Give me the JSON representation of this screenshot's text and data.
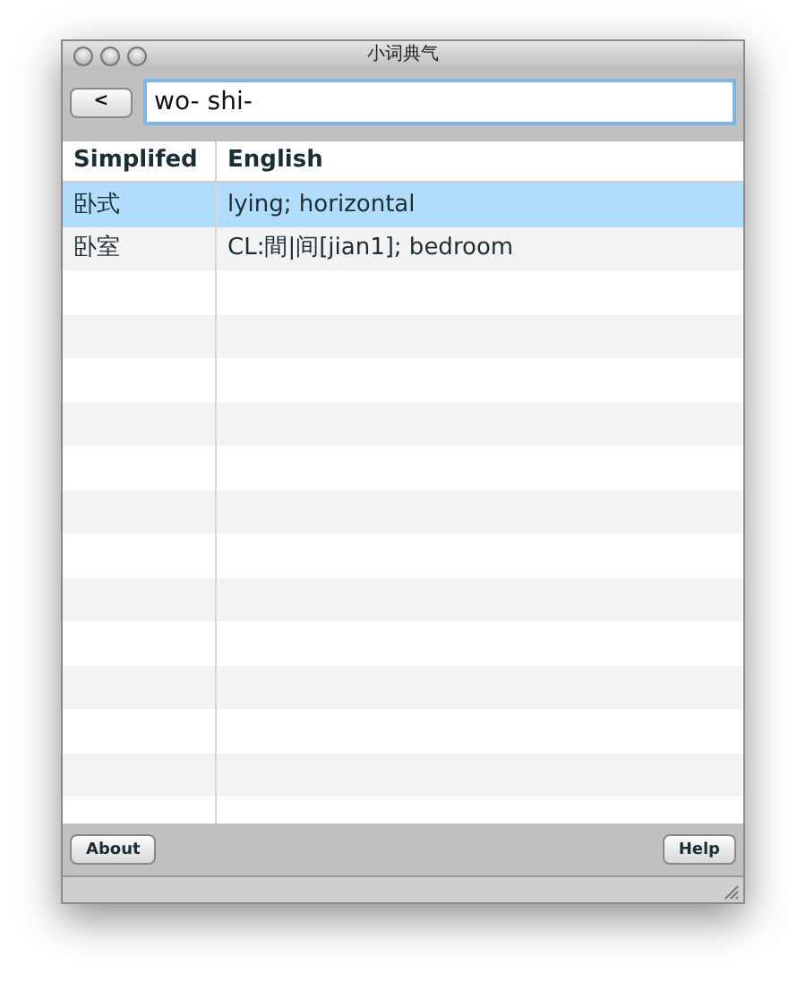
{
  "window": {
    "title": "小词典气"
  },
  "toolbar": {
    "back_button": "<",
    "search": {
      "value": "wo- shi-"
    }
  },
  "table": {
    "columns": [
      "Simplifed",
      "English"
    ],
    "rows": [
      {
        "simplified": "卧式",
        "english": "lying; horizontal",
        "selected": true
      },
      {
        "simplified": "卧室",
        "english": "CL:間|间[jian1]; bedroom",
        "selected": false
      }
    ]
  },
  "footer": {
    "buttons": [
      "About",
      "Help"
    ]
  }
}
